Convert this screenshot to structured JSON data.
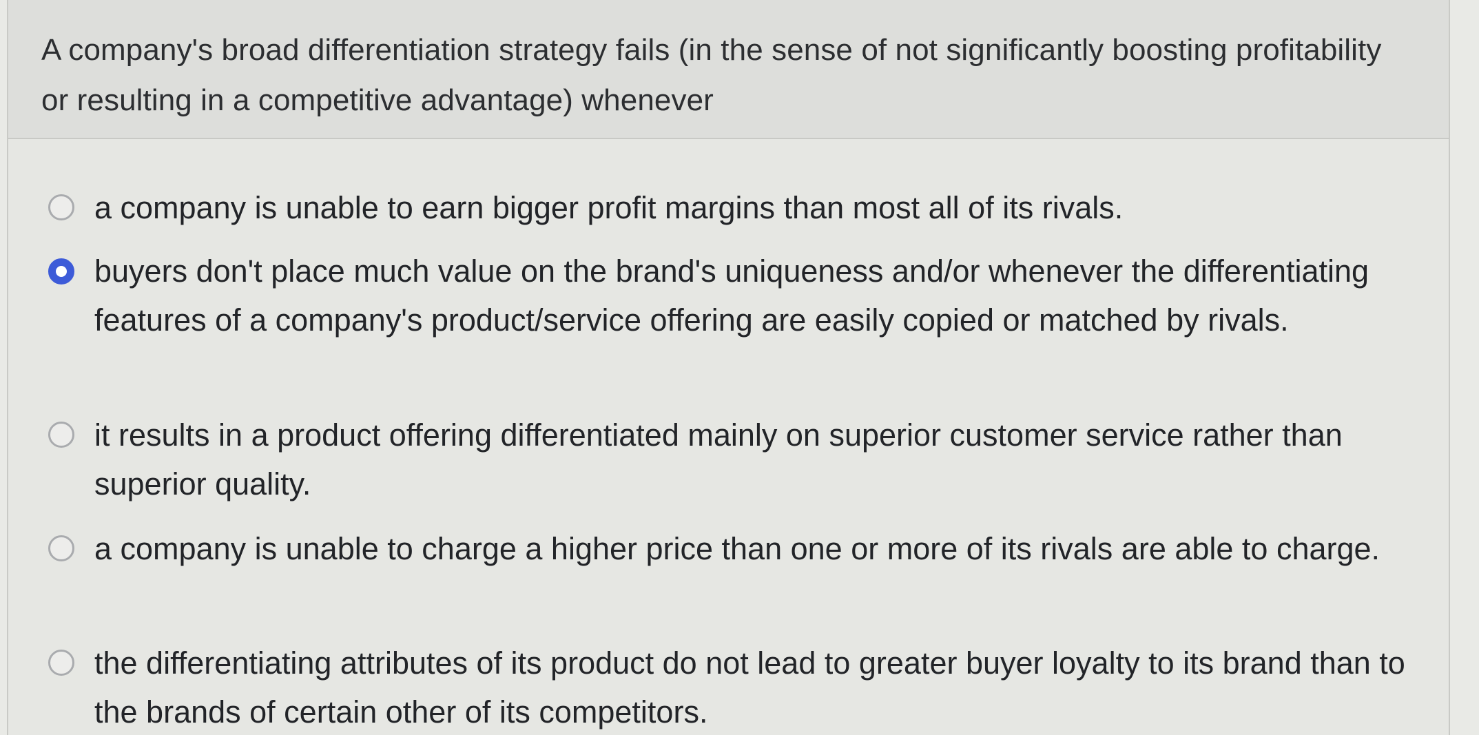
{
  "question": {
    "text": "A company's broad differentiation strategy fails (in the sense of not significantly boosting profitability or resulting in a competitive advantage) whenever"
  },
  "choices": [
    {
      "label": "a company is unable to earn bigger profit margins than most all of its rivals.",
      "selected": false
    },
    {
      "label": "buyers don't place much value on the brand's uniqueness and/or whenever the differentiating features of a company's product/service offering are easily copied or matched by rivals.",
      "selected": true
    },
    {
      "label": "it results in a product offering differentiated mainly on superior customer service rather than superior quality.",
      "selected": false
    },
    {
      "label": "a company is unable to charge a higher price than one or more of its rivals are able to charge.",
      "selected": false
    },
    {
      "label": "the differentiating attributes of its product do not lead to greater buyer loyalty to its brand than to the brands of certain other of its competitors.",
      "selected": false
    }
  ],
  "colors": {
    "selected_radio": "#3d5bd8",
    "radio_border": "#a9abae",
    "header_bg": "#dddedb",
    "body_bg": "#e6e7e3"
  }
}
